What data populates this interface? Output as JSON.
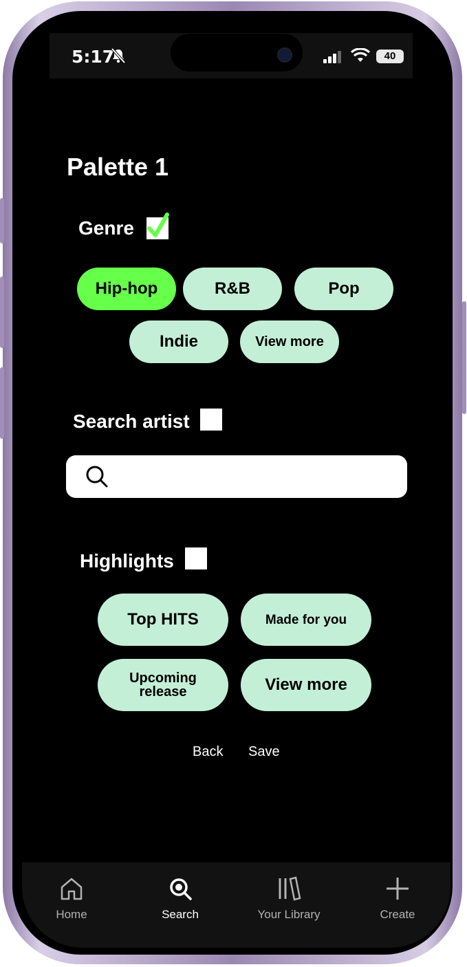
{
  "status_bar": {
    "time": "5:17",
    "battery": "40"
  },
  "page": {
    "title": "Palette 1"
  },
  "genre": {
    "label": "Genre",
    "checked": true,
    "chips": [
      {
        "label": "Hip-hop",
        "selected": true
      },
      {
        "label": "R&B",
        "selected": false
      },
      {
        "label": "Pop",
        "selected": false
      },
      {
        "label": "Indie",
        "selected": false
      },
      {
        "label": "View more",
        "selected": false
      }
    ]
  },
  "search_artist": {
    "label": "Search artist",
    "checked": false,
    "placeholder": ""
  },
  "highlights": {
    "label": "Highlights",
    "checked": false,
    "chips": [
      {
        "label": "Top HITS"
      },
      {
        "label": "Made for you"
      },
      {
        "label": "Upcoming release"
      },
      {
        "label": "View more"
      }
    ]
  },
  "actions": {
    "back": "Back",
    "save": "Save"
  },
  "tabbar": {
    "items": [
      {
        "label": "Home",
        "icon": "home-icon",
        "active": false
      },
      {
        "label": "Search",
        "icon": "search-icon",
        "active": true
      },
      {
        "label": "Your Library",
        "icon": "library-icon",
        "active": false
      },
      {
        "label": "Create",
        "icon": "plus-icon",
        "active": false
      }
    ]
  },
  "colors": {
    "accent_selected": "#66ff4a",
    "chip": "#c3efd6",
    "check": "#66ff4a"
  }
}
